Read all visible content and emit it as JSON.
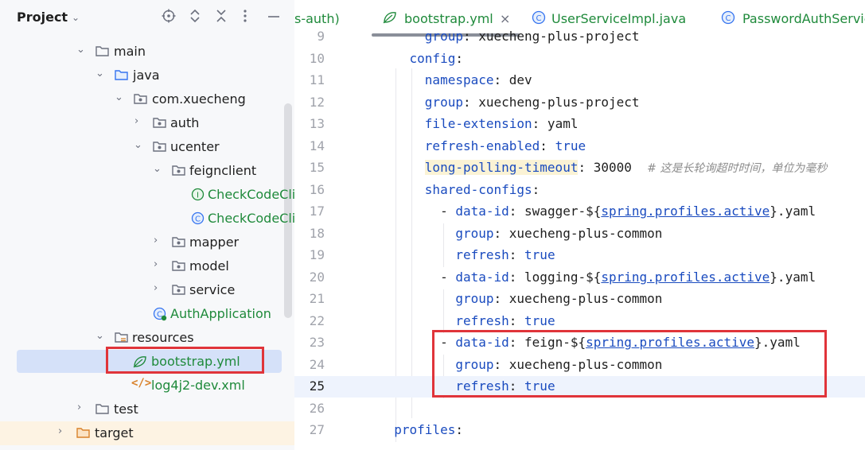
{
  "project": {
    "title": "Project",
    "tree": [
      {
        "label": "main",
        "type": "folder"
      },
      {
        "label": "java",
        "type": "source-folder"
      },
      {
        "label": "com.xuecheng",
        "type": "package"
      },
      {
        "label": "auth",
        "type": "package"
      },
      {
        "label": "ucenter",
        "type": "package"
      },
      {
        "label": "feignclient",
        "type": "package"
      },
      {
        "label": "CheckCodeCli",
        "type": "interface"
      },
      {
        "label": "CheckCodeCli",
        "type": "class"
      },
      {
        "label": "mapper",
        "type": "package"
      },
      {
        "label": "model",
        "type": "package"
      },
      {
        "label": "service",
        "type": "package"
      },
      {
        "label": "AuthApplication",
        "type": "spring-class"
      },
      {
        "label": "resources",
        "type": "resources-folder"
      },
      {
        "label": "bootstrap.yml",
        "type": "yml"
      },
      {
        "label": "log4j2-dev.xml",
        "type": "xml"
      },
      {
        "label": "test",
        "type": "folder"
      },
      {
        "label": "target",
        "type": "excluded-folder"
      }
    ]
  },
  "tabs": [
    {
      "label": "s-auth)",
      "active": false
    },
    {
      "label": "bootstrap.yml",
      "active": true,
      "close": "×"
    },
    {
      "label": "UserServiceImpl.java",
      "active": false
    },
    {
      "label": "PasswordAuthServic",
      "active": false
    }
  ],
  "code": {
    "lines": [
      {
        "n": "9",
        "indent": "      ",
        "key": "group",
        "value": " xuecheng-plus-project"
      },
      {
        "n": "10",
        "indent": "    ",
        "key": "config",
        "value": ""
      },
      {
        "n": "11",
        "indent": "      ",
        "key": "namespace",
        "value": " dev"
      },
      {
        "n": "12",
        "indent": "      ",
        "key": "group",
        "value": " xuecheng-plus-project"
      },
      {
        "n": "13",
        "indent": "      ",
        "key": "file-extension",
        "value": " yaml"
      },
      {
        "n": "14",
        "indent": "      ",
        "key": "refresh-enabled",
        "value": " true"
      },
      {
        "n": "15",
        "indent": "      ",
        "key": "long-polling-timeout",
        "value": " 30000  ",
        "comment": "# 这是长轮询超时时间，单位为毫秒"
      },
      {
        "n": "16",
        "indent": "      ",
        "key": "shared-configs",
        "value": ""
      },
      {
        "n": "17",
        "indent": "        - ",
        "key": "data-id",
        "value": " swagger-${",
        "link": "spring.profiles.active",
        "after": "}.yaml"
      },
      {
        "n": "18",
        "indent": "          ",
        "key": "group",
        "value": " xuecheng-plus-common"
      },
      {
        "n": "19",
        "indent": "          ",
        "key": "refresh",
        "value": " true"
      },
      {
        "n": "20",
        "indent": "        - ",
        "key": "data-id",
        "value": " logging-${",
        "link": "spring.profiles.active",
        "after": "}.yaml"
      },
      {
        "n": "21",
        "indent": "          ",
        "key": "group",
        "value": " xuecheng-plus-common"
      },
      {
        "n": "22",
        "indent": "          ",
        "key": "refresh",
        "value": " true"
      },
      {
        "n": "23",
        "indent": "        - ",
        "key": "data-id",
        "value": " feign-${",
        "link": "spring.profiles.active",
        "after": "}.yaml"
      },
      {
        "n": "24",
        "indent": "          ",
        "key": "group",
        "value": " xuecheng-plus-common"
      },
      {
        "n": "25",
        "indent": "          ",
        "key": "refresh",
        "value": " true"
      },
      {
        "n": "26",
        "indent": "",
        "key": "",
        "value": ""
      },
      {
        "n": "27",
        "indent": "  ",
        "key": "profiles",
        "value": ""
      }
    ]
  },
  "colors": {
    "accent_red": "#e0343a",
    "selection": "#d5e1f9",
    "key": "#1a4bbf",
    "green_file": "#1f8a3b"
  }
}
